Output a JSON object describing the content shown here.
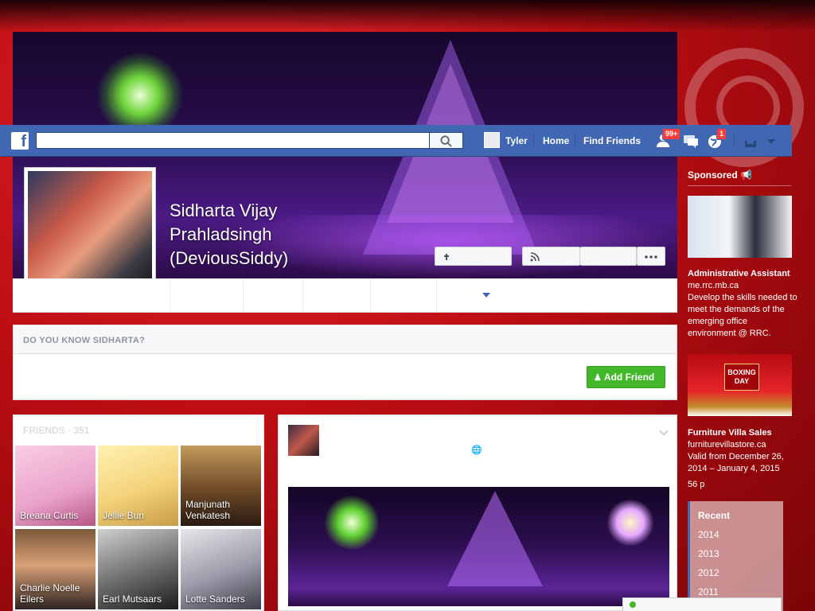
{
  "topbar": {
    "logo": "f",
    "search_value": "",
    "user_name": "Tyler",
    "home_label": "Home",
    "find_friends_label": "Find Friends",
    "friend_requests_badge": "99+",
    "notifications_badge": "1"
  },
  "profile": {
    "name_line1": "Sidharta Vijay",
    "name_line2": "Prahladsingh",
    "name_line3": "(DeviousSiddy)"
  },
  "know": {
    "header": "Do you know Sidharta?",
    "add_friend_label": "Add Friend"
  },
  "friends": {
    "header": "Friends · 351",
    "items": [
      {
        "name": "Breana Curtis"
      },
      {
        "name": "Jellie Bun"
      },
      {
        "name": "Manjunath\nVenkatesh"
      },
      {
        "name": "Charlie Noelle\nEilers"
      },
      {
        "name": "Earl Mutsaars"
      },
      {
        "name": "Lotte Sanders"
      }
    ]
  },
  "sponsored": {
    "title": "Sponsored",
    "ad1": {
      "title": "Administrative Assistant",
      "domain": "me.rrc.mb.ca",
      "body": "Develop the skills needed to meet the demands of the emerging office environment @ RRC."
    },
    "ad2": {
      "title": "Furniture Villa Sales",
      "domain": "furniturevillastore.ca",
      "body": "Valid from December 26, 2014 – January 4, 2015",
      "banner_line1": "BOXING",
      "banner_line2": "DAY",
      "likes": "56 p"
    }
  },
  "recent": {
    "title": "Recent",
    "years": [
      "2014",
      "2013",
      "2012",
      "2011"
    ]
  },
  "colors": {
    "fb_blue": "#4267b2",
    "green": "#42b72a"
  }
}
